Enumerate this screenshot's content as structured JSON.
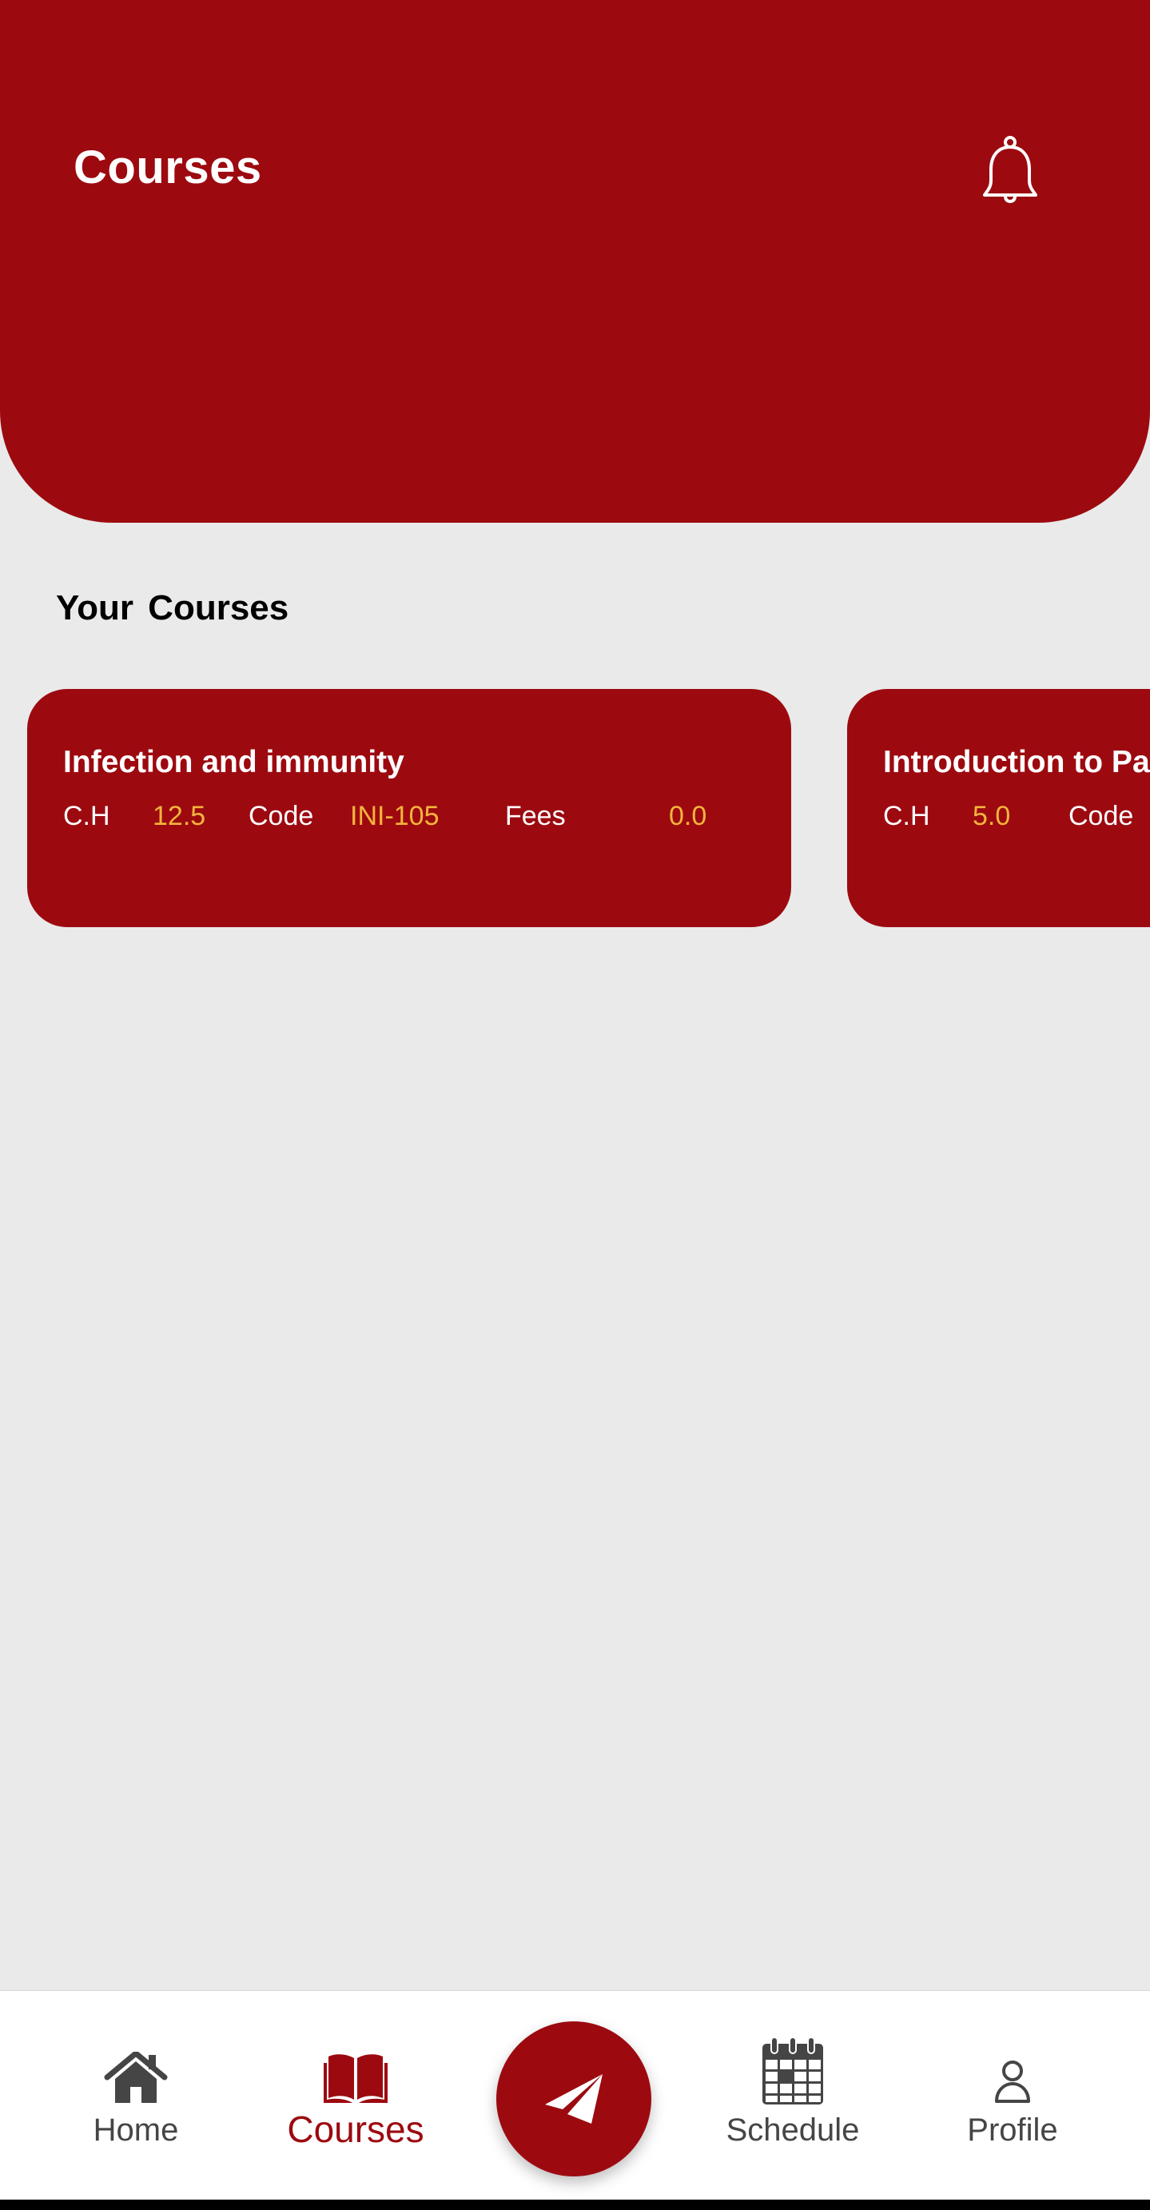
{
  "header": {
    "title": "Courses",
    "notification_icon": "bell-icon"
  },
  "section": {
    "title": "Your Courses"
  },
  "courses": [
    {
      "title": "Infection and immunity",
      "ch_label": "C.H",
      "ch_value": "12.5",
      "code_label": "Code",
      "code_value": "INI-105",
      "fees_label": "Fees",
      "fees_value": "0.0"
    },
    {
      "title": "Introduction to Pa",
      "ch_label": "C.H",
      "ch_value": "5.0",
      "code_label": "Code"
    }
  ],
  "nav": {
    "items": [
      {
        "label": "Home",
        "icon": "home-icon",
        "active": false
      },
      {
        "label": "Courses",
        "icon": "book-open-icon",
        "active": true
      },
      {
        "label": "Schedule",
        "icon": "calendar-icon",
        "active": false
      },
      {
        "label": "Profile",
        "icon": "user-icon",
        "active": false
      }
    ],
    "fab_icon": "paper-plane-icon"
  },
  "colors": {
    "primary": "#9C0A10",
    "accent_value": "#F4B43C",
    "background": "#EAEAEA",
    "nav_inactive": "#454545"
  }
}
